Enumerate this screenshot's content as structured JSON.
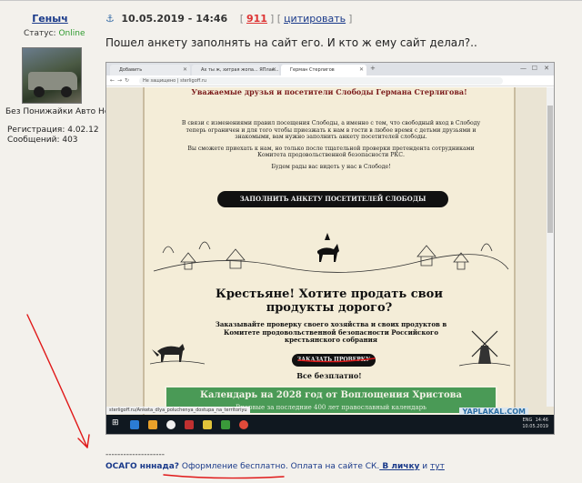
{
  "user": {
    "name": "Геныч",
    "status_label": "Статус:",
    "status_value": "Online",
    "title": "Без Понижайки Авто Нет",
    "registration": "Регистрация: 4.02.12",
    "messages": "Сообщений: 403"
  },
  "post": {
    "anchor": "⚓",
    "date": "10.05.2019 - 14:46",
    "karma": "911",
    "quote": "цитировать",
    "text": "Пошел анкету заполнять на сайт его. И кто ж ему сайт делал?.."
  },
  "screenshot": {
    "tabs": [
      {
        "label": "Добавить"
      },
      {
        "label": "Ах ты ж, хитрая жопа... ЯПлак..."
      },
      {
        "label": "Герман Стерлигов"
      }
    ],
    "address": "Не защищено | sterligoff.ru",
    "site_title": "Уважаемые друзья и посетители Слободы Германа Стерлигова!",
    "intro_p1": "В связи с изменениями правил посещения Слободы, а именно с тем, что свободный вход в Слободу теперь ограничен и для того чтобы приезжать к нам в гости в любое время с детьми друзьями и знакомыми, вам нужно заполнить анкету посетителей слободы.",
    "intro_p2": "Вы сможете приехать к нам, но только после тщательной проверки претендента сотрудниками Комитета продовольственной безопасности РКС.",
    "intro_p3": "Будем рады вас видеть у нас в Слободе!",
    "fill_button": "ЗАПОЛНИТЬ АНКЕТУ ПОСЕТИТЕЛЕЙ СЛОБОДЫ",
    "promo_title_1": "Крестьяне! Хотите продать свои",
    "promo_title_2": "продукты дорого?",
    "promo_text": "Заказывайте проверку своего хозяйства и своих продуктов в Комитете продовольственной безопасности Российского крестьянского собрания",
    "order_button": "ЗАКАЗАТЬ ПРОВЕРКУ",
    "free": "Все безплатно!",
    "banner_title": "Календарь на 2028 год от Воплощения Христова",
    "banner_sub": "Впервые за последние 400 лет православный календарь",
    "statusbar": "sterligoff.ru/Anketa_dlya_poluchenya_dostupa_na_territoriyu",
    "time": "14:46",
    "date": "10.05.2019",
    "lang": "ENG",
    "watermark": "YAPLAKAL.COM"
  },
  "signature": {
    "dashes": "--------------------",
    "part1": "ОСАГО нннада?",
    "part2": " Оформление бесплатно. Оплата на сайте СК.",
    "part3": " В личку",
    "part4": " и ",
    "part5": "тут"
  },
  "colors": {
    "link": "#1a3a8a",
    "karma": "#d33333",
    "online": "#2e9a2e",
    "annotation": "#e01818"
  }
}
